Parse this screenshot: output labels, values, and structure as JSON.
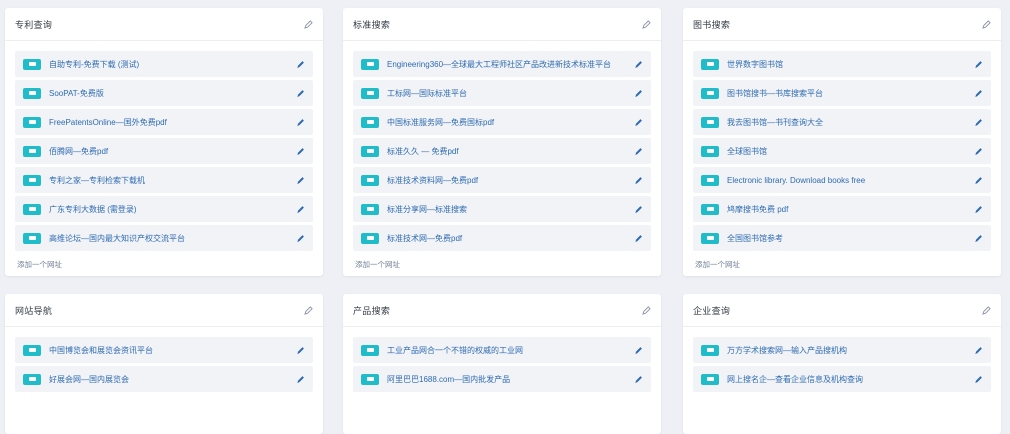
{
  "colors": {
    "background": "#eef0f5",
    "card": "#ffffff",
    "item_bg": "#f2f3f7",
    "icon_teal": "#20bcc9",
    "link_blue": "#2d6bb1"
  },
  "icons": {
    "item": "browser-tab-icon",
    "edit": "pencil-icon"
  },
  "add_label": "添加一个网址",
  "panels": [
    {
      "title": "专利查询",
      "items": [
        "自助专利-免费下载 (测试)",
        "SooPAT-免费版",
        "FreePatentsOnline—国外免费pdf",
        "佰腾网—免费pdf",
        "专利之家—专利检索下载机",
        "广东专利大数据 (需登录)",
        "高维论坛—国内最大知识产权交流平台"
      ]
    },
    {
      "title": "标准搜索",
      "items": [
        "Engineering360—全球最大工程师社区产品改进新技术标准平台",
        "工标网—国际标准平台",
        "中国标准服务网—免费国标pdf",
        "标准久久 — 免费pdf",
        "标准技术资料网—免费pdf",
        "标准分享网—标准搜索",
        "标准技术网—免费pdf"
      ]
    },
    {
      "title": "图书搜索",
      "items": [
        "世界数字图书馆",
        "图书馆搜书—书库搜索平台",
        "我去图书馆—书刊查询大全",
        "全球图书馆",
        "Electronic library. Download books free",
        "鸠摩搜书免费 pdf",
        "全国图书馆参考"
      ]
    },
    {
      "title": "网站导航",
      "items": [
        "中国博览会和展览会资讯平台",
        "好展会网—国内展览会"
      ]
    },
    {
      "title": "产品搜索",
      "items": [
        "工业产品网合一个不错的权威的工业网",
        "阿里巴巴1688.com—国内批发产品"
      ]
    },
    {
      "title": "企业查询",
      "items": [
        "万方学术搜索网—输入产品搜机构",
        "网上搜名企—查看企业信息及机构查询"
      ]
    }
  ]
}
